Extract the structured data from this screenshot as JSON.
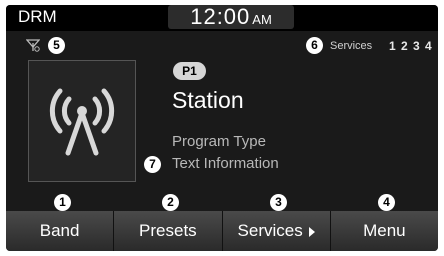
{
  "status": {
    "mode": "DRM",
    "time": "12:00",
    "ampm": "AM"
  },
  "callouts": {
    "c1": "1",
    "c2": "2",
    "c3": "3",
    "c4": "4",
    "c5": "5",
    "c6": "6",
    "c7": "7"
  },
  "services": {
    "label": "Services",
    "numbers": "1 2 3 4"
  },
  "station": {
    "preset": "P1",
    "name": "Station",
    "program_type": "Program Type",
    "text_info": "Text Information"
  },
  "softkeys": {
    "band": "Band",
    "presets": "Presets",
    "services": "Services",
    "menu": "Menu"
  },
  "icons": {
    "signal": "signal-reception-icon",
    "broadcast": "broadcast-antenna-icon",
    "arrow": "chevron-right-icon"
  }
}
